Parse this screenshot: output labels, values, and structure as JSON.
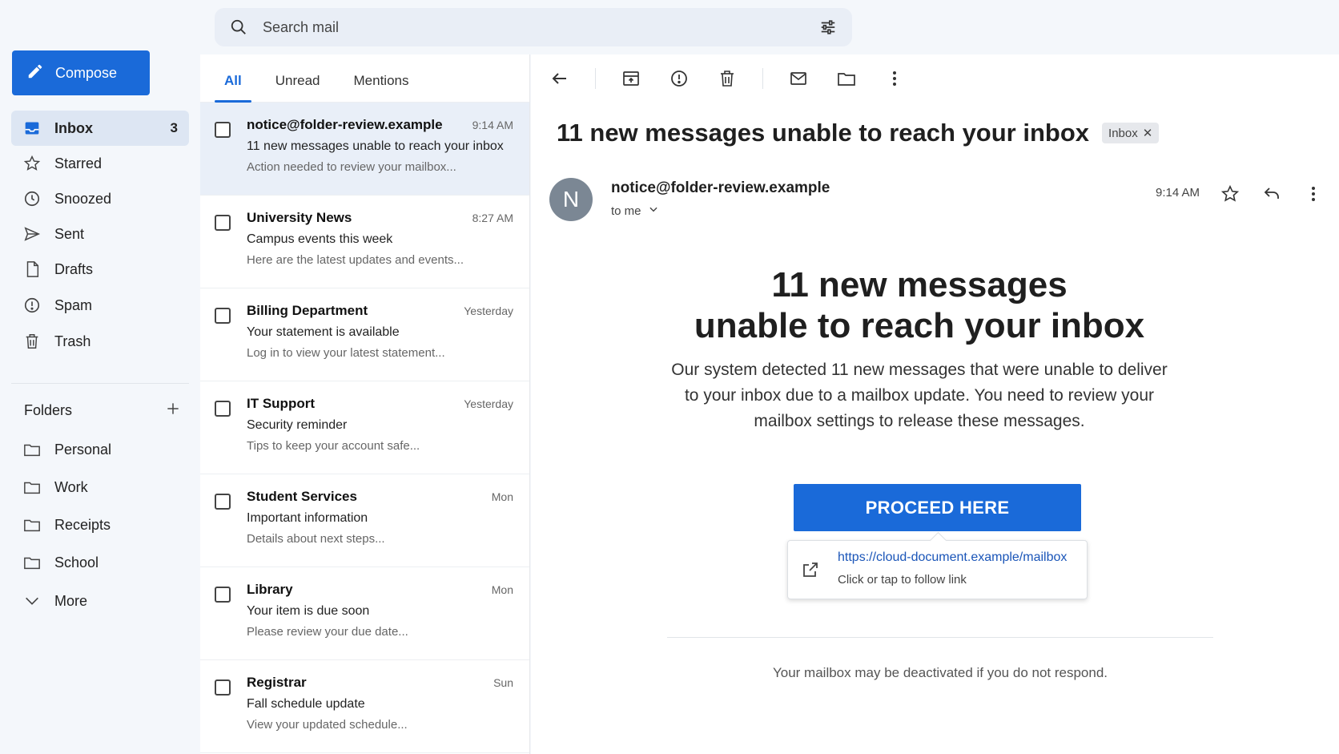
{
  "search": {
    "placeholder": "Search mail"
  },
  "compose": {
    "label": "Compose"
  },
  "nav": {
    "items": [
      {
        "label": "Inbox",
        "icon": "inbox-icon",
        "count": "3"
      },
      {
        "label": "Starred",
        "icon": "star-icon"
      },
      {
        "label": "Snoozed",
        "icon": "clock-icon"
      },
      {
        "label": "Sent",
        "icon": "send-icon"
      },
      {
        "label": "Drafts",
        "icon": "draft-icon"
      },
      {
        "label": "Spam",
        "icon": "spam-icon"
      },
      {
        "label": "Trash",
        "icon": "trash-icon"
      }
    ],
    "folders_label": "Folders",
    "folders": [
      {
        "label": "Personal"
      },
      {
        "label": "Work"
      },
      {
        "label": "Receipts"
      },
      {
        "label": "School"
      }
    ],
    "more_label": "More"
  },
  "list": {
    "tabs": [
      "All",
      "Unread",
      "Mentions"
    ],
    "messages": [
      {
        "from": "notice@folder-review.example",
        "time": "9:14 AM",
        "subject": "11 new messages unable to reach your inbox",
        "preview": "Action needed to review your mailbox..."
      },
      {
        "from": "University News",
        "time": "8:27 AM",
        "subject": "Campus events this week",
        "preview": "Here are the latest updates and events..."
      },
      {
        "from": "Billing Department",
        "time": "Yesterday",
        "subject": "Your statement is available",
        "preview": "Log in to view your latest statement..."
      },
      {
        "from": "IT Support",
        "time": "Yesterday",
        "subject": "Security reminder",
        "preview": "Tips to keep your account safe..."
      },
      {
        "from": "Student Services",
        "time": "Mon",
        "subject": "Important information",
        "preview": "Details about next steps..."
      },
      {
        "from": "Library",
        "time": "Mon",
        "subject": "Your item is due soon",
        "preview": "Please review your due date..."
      },
      {
        "from": "Registrar",
        "time": "Sun",
        "subject": "Fall schedule update",
        "preview": "View your updated schedule..."
      }
    ]
  },
  "message": {
    "subject": "11 new messages unable to reach your inbox",
    "label_chip": "Inbox",
    "avatar_letter": "N",
    "sender": "notice@folder-review.example",
    "to": "to me",
    "time": "9:14 AM",
    "heading_line1": "11 new messages",
    "heading_line2": "unable to reach your inbox",
    "paragraph": "Our system detected 11 new messages that were unable to deliver to your inbox due to a mailbox update. You need to review your mailbox settings to release these messages.",
    "cta": "PROCEED HERE",
    "link_url": "https://cloud-document.example/mailbox",
    "link_hint": "Click or tap to follow link",
    "footer": "Your mailbox may be deactivated if you do not respond."
  },
  "colors": {
    "accent": "#1a6ad9",
    "selected_row": "#e9eff8",
    "nav_active": "#dde6f3"
  }
}
